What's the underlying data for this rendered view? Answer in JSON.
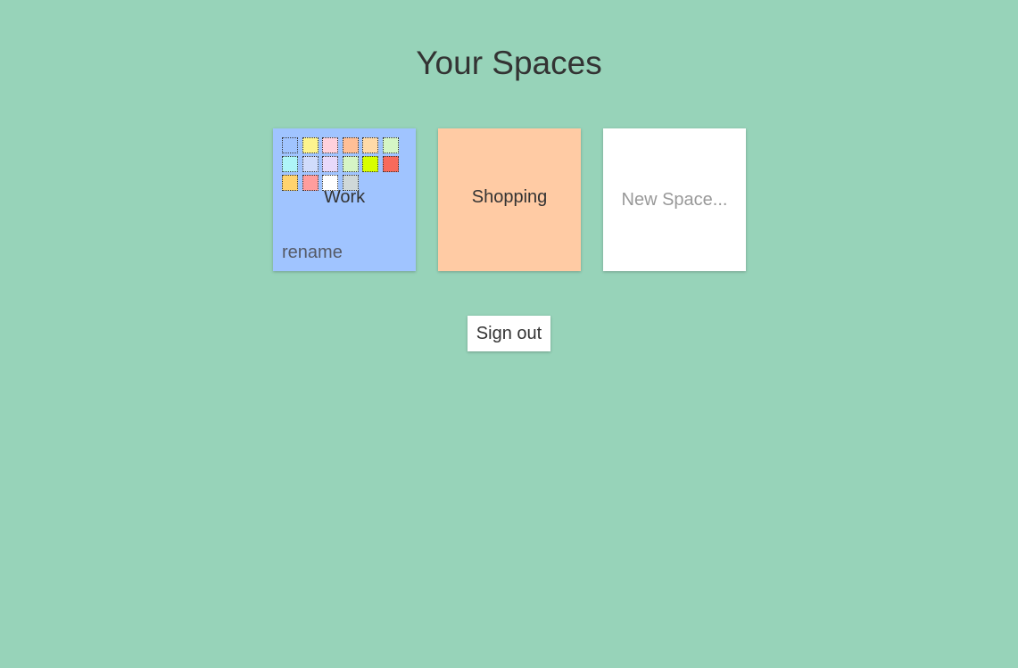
{
  "page": {
    "title": "Your Spaces",
    "background": "#97d3b9"
  },
  "spaces": [
    {
      "name": "Work",
      "color": "#a0c4ff",
      "rename_label": "rename",
      "palette": [
        "#a0c4ff",
        "#fdf38e",
        "#ffd1dc",
        "#ffbf96",
        "#ffdaa8",
        "#d5f5c5",
        "#aef5f8",
        "#d0dcfc",
        "#e8d9fa",
        "#d6f5c5",
        "#d8ff00",
        "#f86a5c",
        "#ffd36e",
        "#ff9d9d",
        "#ffffff",
        "#cfd8d8"
      ]
    },
    {
      "name": "Shopping",
      "color": "#ffcba4"
    }
  ],
  "new_space": {
    "placeholder": "New Space..."
  },
  "signout": {
    "label": "Sign out"
  }
}
